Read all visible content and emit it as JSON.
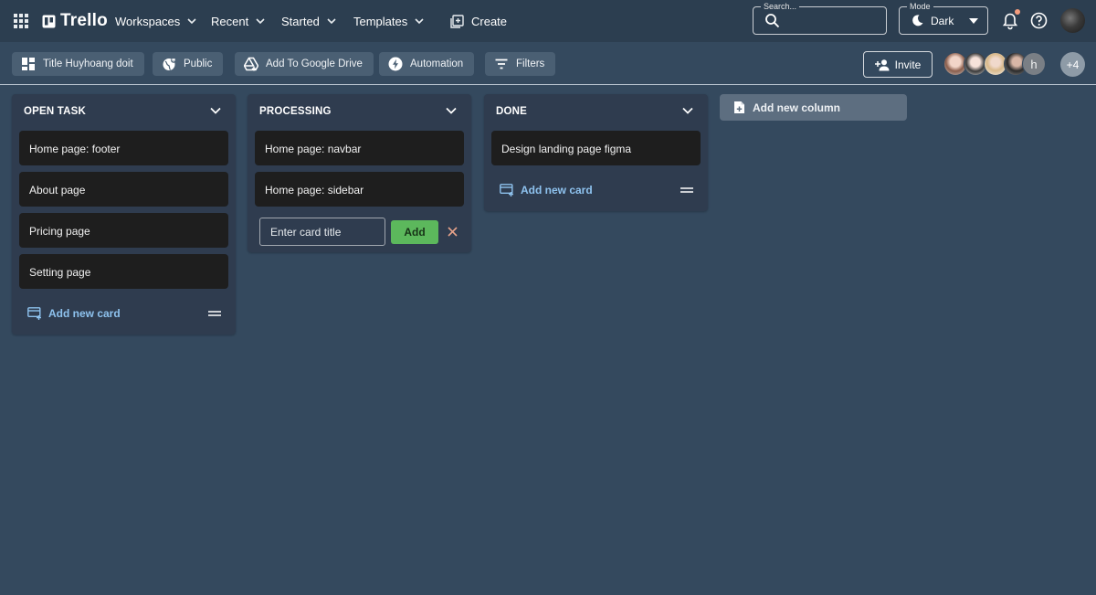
{
  "app": {
    "name": "Trello"
  },
  "nav": {
    "workspaces": "Workspaces",
    "recent": "Recent",
    "started": "Started",
    "templates": "Templates",
    "create": "Create"
  },
  "search": {
    "legend": "Search...",
    "value": ""
  },
  "mode": {
    "legend": "Mode",
    "value": "Dark"
  },
  "board_toolbar": {
    "title": "Title Huyhoang doit",
    "visibility": "Public",
    "google_drive": "Add To Google Drive",
    "automation": "Automation",
    "filters": "Filters",
    "invite": "Invite"
  },
  "members": {
    "letter_avatar": "h",
    "more": "+4"
  },
  "columns": [
    {
      "title": "OPEN TASK",
      "cards": [
        "Home page: footer",
        "About page",
        "Pricing page",
        "Setting page"
      ],
      "add_card_label": "Add new card"
    },
    {
      "title": "PROCESSING",
      "cards": [
        "Home page: navbar",
        "Home page: sidebar"
      ],
      "new_card_placeholder": "Enter card title",
      "add_button": "Add"
    },
    {
      "title": "DONE",
      "cards": [
        "Design landing page figma"
      ],
      "add_card_label": "Add new card"
    }
  ],
  "add_column_label": "Add new column",
  "colors": {
    "appbar": "#2c3e50",
    "board_bg": "#34495e",
    "column_bg": "#2f3c4f",
    "card_bg": "#1e1e1e",
    "accent_link": "#8ec2ee",
    "add_green": "#5cb85c",
    "notification_dot": "#f39c7d"
  },
  "icons": [
    "apps-grid-icon",
    "trello-logo-icon",
    "chevron-down-icon",
    "add-box-icon",
    "search-icon",
    "moon-icon",
    "caret-down-icon",
    "bell-icon",
    "help-icon",
    "dashboard-icon",
    "public-globe-icon",
    "google-drive-icon",
    "bolt-icon",
    "filter-icon",
    "person-add-icon",
    "add-card-icon",
    "drag-handle-icon",
    "close-icon",
    "note-add-icon"
  ]
}
